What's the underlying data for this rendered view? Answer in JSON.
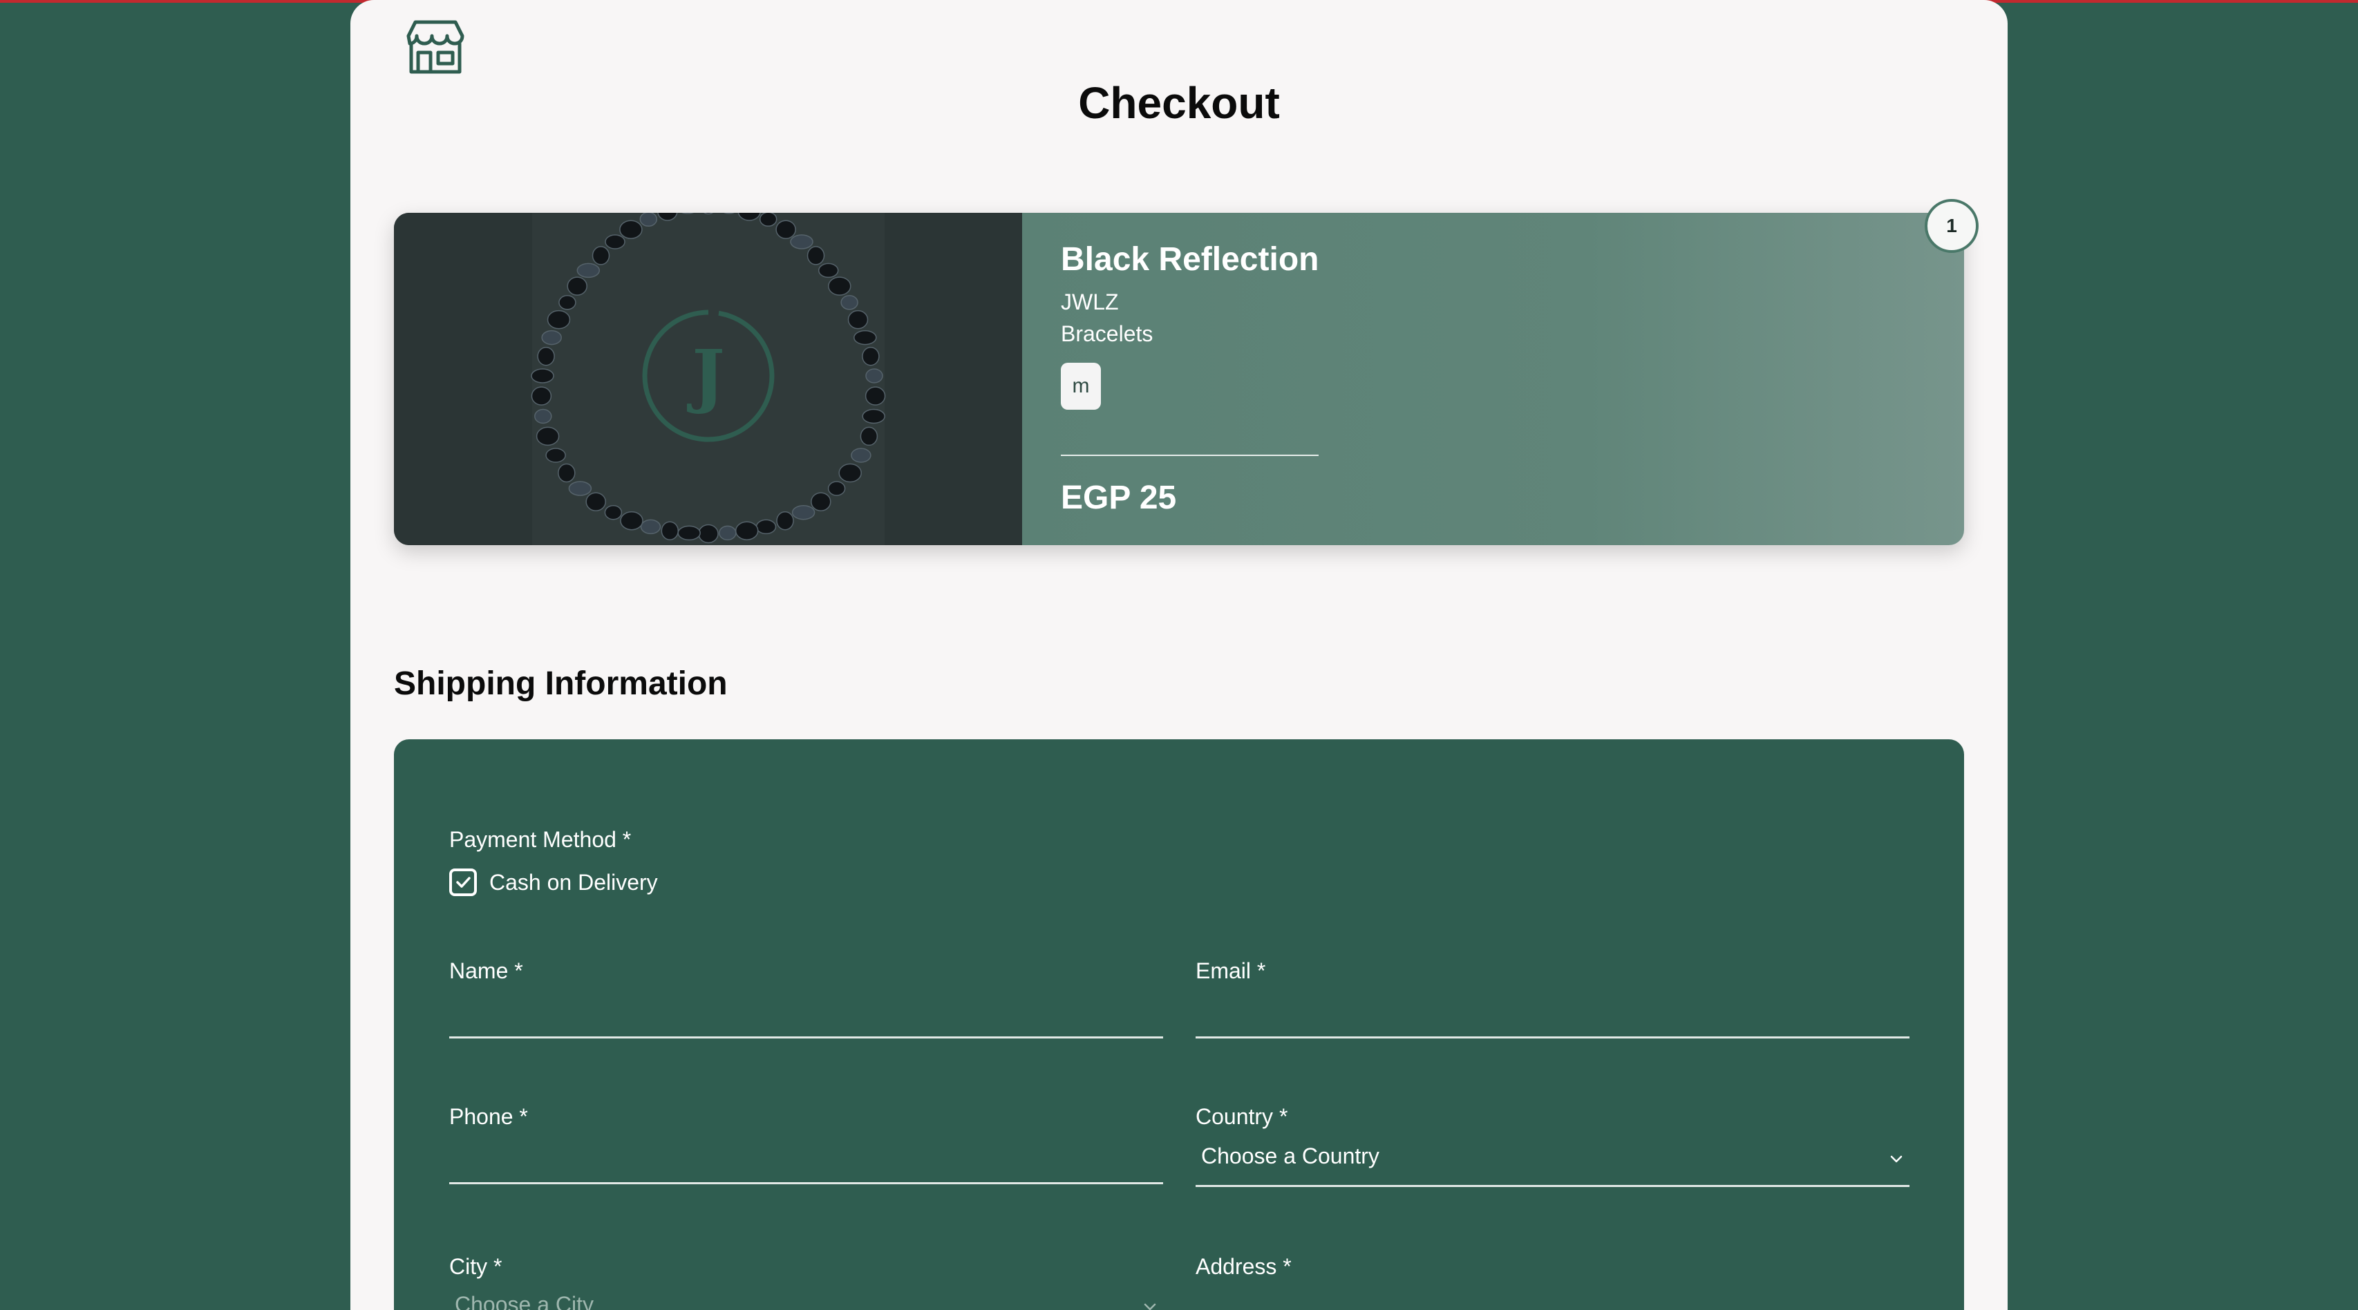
{
  "page": {
    "title": "Checkout"
  },
  "product": {
    "name": "Black Reflection",
    "brand": "JWLZ",
    "category": "Bracelets",
    "size": "m",
    "price": "EGP 25",
    "quantity": "1",
    "image_logo_letter": "J"
  },
  "shipping": {
    "title": "Shipping Information",
    "payment_method_label": "Payment Method *",
    "payment_option": "Cash on Delivery",
    "payment_option_checked": true,
    "name_label": "Name *",
    "name_value": "",
    "email_label": "Email *",
    "email_value": "",
    "phone_label": "Phone *",
    "phone_value": "",
    "country_label": "Country *",
    "country_placeholder": "Choose a Country",
    "city_label": "City *",
    "city_placeholder": "Choose a City",
    "address_label": "Address *",
    "address_value": ""
  },
  "colors": {
    "background": "#2f5d50",
    "card": "#f8f6f6",
    "accent_red": "#c2292f",
    "form_bg": "#2f5d50"
  },
  "icons": {
    "store": "store-icon",
    "check": "check-icon",
    "chevron": "chevron-down-icon"
  }
}
